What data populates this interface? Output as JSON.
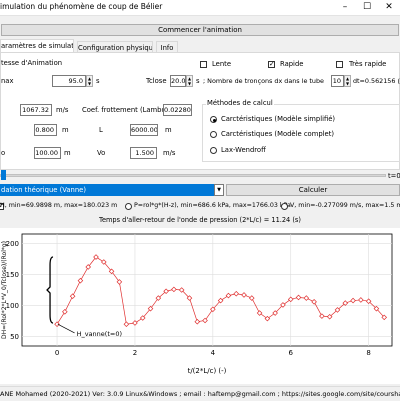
{
  "window": {
    "title": "imulation du phénomène de coup de Bélier",
    "minimize_icon": "minimize-icon",
    "maximize_icon": "maximize-icon",
    "close_icon": "close-icon"
  },
  "toolbar": {
    "start_animation_label": "Commencer l'animation"
  },
  "tabs": [
    {
      "label": "aramètres de simulation",
      "active": true
    },
    {
      "label": "Configuration physique",
      "active": false
    },
    {
      "label": "Info",
      "active": false
    }
  ],
  "animation": {
    "speed_group_label": "tesse d'Animation",
    "speed_options": [
      {
        "label": "Lente",
        "checked": false
      },
      {
        "label": "Rapide",
        "checked": true
      },
      {
        "label": "Très rapide",
        "checked": false
      }
    ],
    "tmax_label": "nax",
    "tmax_value": "95.0",
    "tmax_unit": "s",
    "tclose_label": "Tclose",
    "tclose_value": "20.0",
    "tclose_unit": "s",
    "segments_label": "; Nombre de tronçons dx dans le tube",
    "segments_value": "10",
    "segments_unit": "s",
    "dt_label": "dt=0.562156 ("
  },
  "params": {
    "c_value": "1067.32",
    "c_unit": "m/s",
    "lambda_label": "Coef. frottement (Lambda)",
    "lambda_value": "0.02280",
    "d_value": "0.800",
    "d_unit": "m",
    "l_label": "L",
    "l_value": "6000.00",
    "l_unit": "m",
    "h_label": "o",
    "h_value": "100.00",
    "h_unit": "m",
    "vo_label": "Vo",
    "vo_value": "1.500",
    "vo_unit": "m/s"
  },
  "methods": {
    "group_label": "Méthodes de calcul",
    "options": [
      {
        "label": "Carctéristiques (Modèle simplifié)",
        "checked": true
      },
      {
        "label": "Carctéristiques (Modèle complet)",
        "checked": false
      },
      {
        "label": "Lax-Wendroff",
        "checked": false
      }
    ]
  },
  "slider": {
    "label": "t=0."
  },
  "calc": {
    "select_value": "dation théorique (Vanne)",
    "calculate_label": "Calculer"
  },
  "legend": {
    "h_text": "H, min=69.9898 m, max=180.023 m",
    "p_text": "P=rol*g*(H-z), min=686.6 kPa, max=1766.03 kPa",
    "v_text": "V, min=-0.277099 m/s, max=1.5 m/s",
    "h_checked": true,
    "p_checked": false,
    "v_checked": false
  },
  "chart_title": "Temps d'aller-retour de l'onde de pression (2*L/c) = 11.24 (s)",
  "chart_data": {
    "type": "line",
    "title": "Temps d'aller-retour de l'onde de pression (2*L/c) = 11.24 (s)",
    "xlabel": "t/(2*L/c) (-)",
    "ylabel": "DH=(Rol*2*L*V_0/Tclose)/(Rol*g)",
    "xlim": [
      -0.9,
      8.6
    ],
    "ylim": [
      35,
      215
    ],
    "x_ticks": [
      0,
      2,
      4,
      6,
      8
    ],
    "y_ticks": [
      50,
      100,
      150,
      200
    ],
    "grid": true,
    "annotation": "H_vanne(t=0)",
    "series": [
      {
        "marker": "diamond",
        "color": "#e03030",
        "x": [
          0.0,
          0.2,
          0.4,
          0.6,
          0.8,
          1.0,
          1.2,
          1.4,
          1.6,
          1.78,
          2.0,
          2.2,
          2.4,
          2.6,
          2.8,
          3.0,
          3.2,
          3.4,
          3.6,
          3.8,
          4.0,
          4.2,
          4.4,
          4.6,
          4.8,
          5.0,
          5.2,
          5.4,
          5.6,
          5.8,
          6.0,
          6.2,
          6.4,
          6.6,
          6.8,
          7.0,
          7.2,
          7.4,
          7.6,
          7.8,
          8.0,
          8.2,
          8.4
        ],
        "y": [
          70,
          90,
          115,
          140,
          162,
          178,
          170,
          155,
          138,
          70,
          72,
          80,
          95,
          112,
          123,
          126,
          125,
          112,
          74,
          76,
          94,
          108,
          116,
          119,
          117,
          112,
          88,
          79,
          88,
          101,
          110,
          113,
          112,
          106,
          83,
          82,
          93,
          104,
          108,
          109,
          107,
          95,
          81
        ]
      }
    ]
  },
  "footer": "ANE Mohamed (2020-2021) Ver: 3.0.9 Linux&Windows ; email : haftemp@gmail.com ; https://sites.google.com/site/courshaf"
}
